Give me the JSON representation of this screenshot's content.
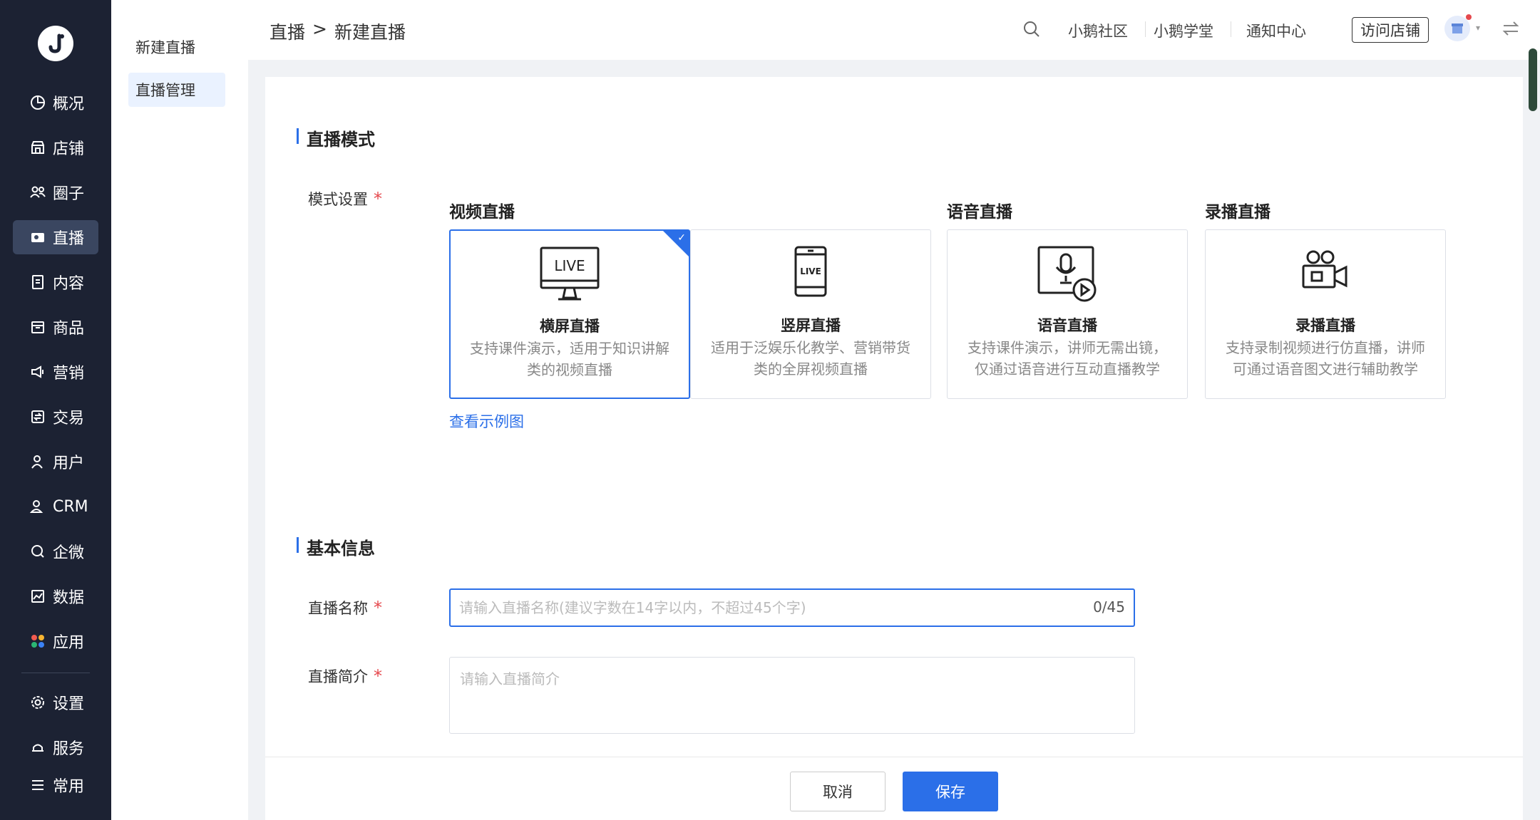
{
  "rail": {
    "items": [
      {
        "label": "概况",
        "icon": "pie-chart-icon"
      },
      {
        "label": "店铺",
        "icon": "store-icon"
      },
      {
        "label": "圈子",
        "icon": "community-icon"
      },
      {
        "label": "直播",
        "icon": "live-camera-icon",
        "active": true
      },
      {
        "label": "内容",
        "icon": "document-icon"
      },
      {
        "label": "商品",
        "icon": "box-icon"
      },
      {
        "label": "营销",
        "icon": "megaphone-icon"
      },
      {
        "label": "交易",
        "icon": "transaction-icon"
      },
      {
        "label": "用户",
        "icon": "user-icon"
      },
      {
        "label": "CRM",
        "icon": "crm-icon"
      },
      {
        "label": "企微",
        "icon": "wecom-icon"
      },
      {
        "label": "数据",
        "icon": "data-chart-icon"
      },
      {
        "label": "应用",
        "icon": "apps-icon"
      },
      {
        "label": "设置",
        "icon": "gear-icon"
      },
      {
        "label": "服务",
        "icon": "service-icon"
      },
      {
        "label": "常用",
        "icon": "list-icon"
      }
    ]
  },
  "submenu": {
    "items": [
      {
        "label": "新建直播"
      },
      {
        "label": "直播管理",
        "active": true
      }
    ]
  },
  "header": {
    "breadcrumb_parent": "直播",
    "breadcrumb_sep": ">",
    "breadcrumb_current": "新建直播",
    "links": [
      "小鹅社区",
      "小鹅学堂",
      "通知中心"
    ],
    "visit_store": "访问店铺"
  },
  "mode_section": {
    "title": "直播模式",
    "field_label": "模式设置",
    "required_mark": "*",
    "groups": [
      "视频直播",
      "语音直播",
      "录播直播"
    ],
    "cards": [
      {
        "name": "横屏直播",
        "desc": "支持课件演示，适用于知识讲解类的视频直播",
        "icon": "monitor-live-icon",
        "selected": true
      },
      {
        "name": "竖屏直播",
        "desc": "适用于泛娱乐化教学、营销带货类的全屏视频直播",
        "icon": "phone-live-icon",
        "selected": false
      },
      {
        "name": "语音直播",
        "desc": "支持课件演示，讲师无需出镜，仅通过语音进行互动直播教学",
        "icon": "microphone-screen-icon",
        "selected": false
      },
      {
        "name": "录播直播",
        "desc": "支持录制视频进行仿直播，讲师可通过语音图文进行辅助教学",
        "icon": "video-camera-icon",
        "selected": false
      }
    ],
    "example_link": "查看示例图"
  },
  "basic_section": {
    "title": "基本信息",
    "name_label": "直播名称",
    "name_placeholder": "请输入直播名称(建议字数在14字以内，不超过45个字)",
    "name_counter": "0/45",
    "intro_label": "直播简介",
    "intro_placeholder": "请输入直播简介",
    "required_mark": "*"
  },
  "footer": {
    "cancel": "取消",
    "save": "保存"
  },
  "colors": {
    "accent": "#2b6fe8",
    "rail_bg": "#1c2233",
    "required": "#e5484d"
  }
}
